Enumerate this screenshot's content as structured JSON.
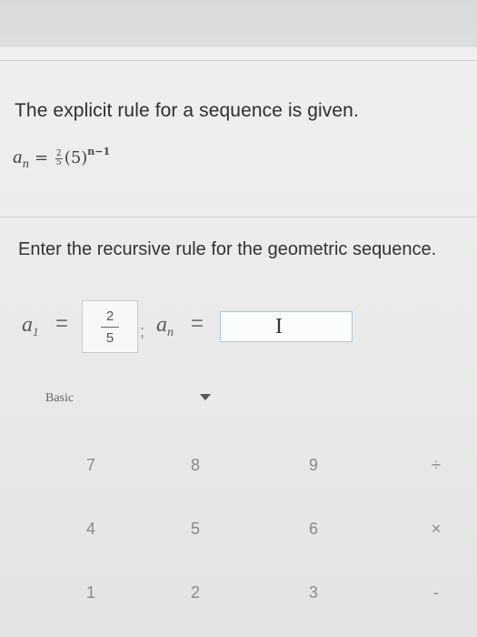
{
  "question": {
    "prompt": "The explicit rule for a sequence is given.",
    "explicit_rule": {
      "var": "a",
      "sub": "n",
      "equals": "=",
      "coef_num": "2",
      "coef_den": "5",
      "base": "(5)",
      "exponent": "n−1"
    },
    "instruction": "Enter the recursive rule for the geometric sequence."
  },
  "answer": {
    "a1_var": "a",
    "a1_sub": "1",
    "equals": "=",
    "a1_num": "2",
    "a1_den": "5",
    "separator": ";",
    "an_var": "a",
    "an_sub": "n",
    "an_value": "",
    "cursor_glyph": "I"
  },
  "keypad": {
    "mode_label": "Basic",
    "keys": [
      {
        "label": "7",
        "name": "key-7"
      },
      {
        "label": "8",
        "name": "key-8"
      },
      {
        "label": "9",
        "name": "key-9"
      },
      {
        "label": "÷",
        "name": "key-divide"
      },
      {
        "label": "4",
        "name": "key-4"
      },
      {
        "label": "5",
        "name": "key-5"
      },
      {
        "label": "6",
        "name": "key-6"
      },
      {
        "label": "×",
        "name": "key-multiply"
      },
      {
        "label": "1",
        "name": "key-1"
      },
      {
        "label": "2",
        "name": "key-2"
      },
      {
        "label": "3",
        "name": "key-3"
      },
      {
        "label": "-",
        "name": "key-minus"
      }
    ]
  }
}
